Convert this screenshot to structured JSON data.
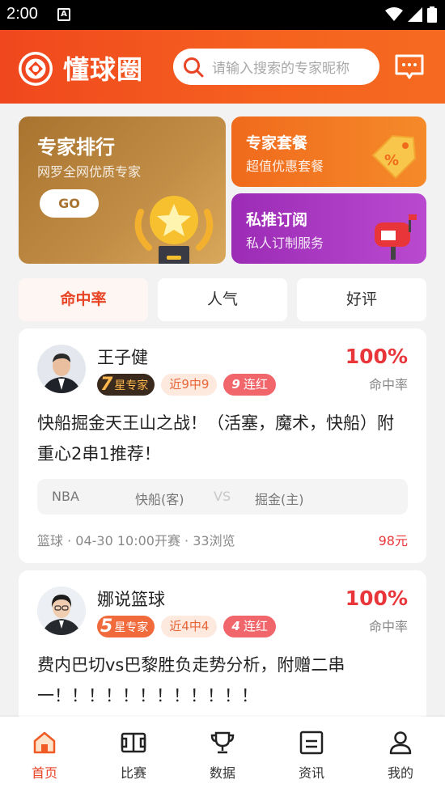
{
  "status_bar": {
    "time": "2:00",
    "notif_letter": "A"
  },
  "header": {
    "logo_text": "懂球圈",
    "search_placeholder": "请输入搜索的专家昵称"
  },
  "features": {
    "rank": {
      "title": "专家排行",
      "subtitle": "网罗全网优质专家",
      "button": "GO"
    },
    "package": {
      "title": "专家套餐",
      "subtitle": "超值优惠套餐"
    },
    "subscribe": {
      "title": "私推订阅",
      "subtitle": "私人订制服务"
    }
  },
  "tabs": [
    {
      "label": "命中率",
      "active": true
    },
    {
      "label": "人气",
      "active": false
    },
    {
      "label": "好评",
      "active": false
    }
  ],
  "posts": [
    {
      "name": "王子健",
      "star_num": "7",
      "star_text": "星专家",
      "record": "近9中9",
      "streak_num": "9",
      "streak_text": "连红",
      "rate": "100%",
      "rate_label": "命中率",
      "title": "快船掘金天王山之战！（活塞，魔术，快船）附重心2串1推荐！",
      "match": {
        "league": "NBA",
        "away": "快船(客)",
        "vs": "VS",
        "home": "掘金(主)"
      },
      "meta": "篮球 · 04-30 10:00开赛 · 33浏览",
      "price": "98元"
    },
    {
      "name": "娜说篮球",
      "star_num": "5",
      "star_text": "星专家",
      "record": "近4中4",
      "streak_num": "4",
      "streak_text": "连红",
      "rate": "100%",
      "rate_label": "命中率",
      "title": "费内巴切vs巴黎胜负走势分析，附赠二串一！！！！！！！！！！！！"
    }
  ],
  "bottom_nav": [
    {
      "label": "首页",
      "icon": "home-icon",
      "active": true
    },
    {
      "label": "比赛",
      "icon": "court-icon",
      "active": false
    },
    {
      "label": "数据",
      "icon": "trophy-icon",
      "active": false
    },
    {
      "label": "资讯",
      "icon": "news-icon",
      "active": false
    },
    {
      "label": "我的",
      "icon": "user-icon",
      "active": false
    }
  ],
  "colors": {
    "accent": "#e84426",
    "header": "#f0471e",
    "gold": "#a8732e"
  }
}
